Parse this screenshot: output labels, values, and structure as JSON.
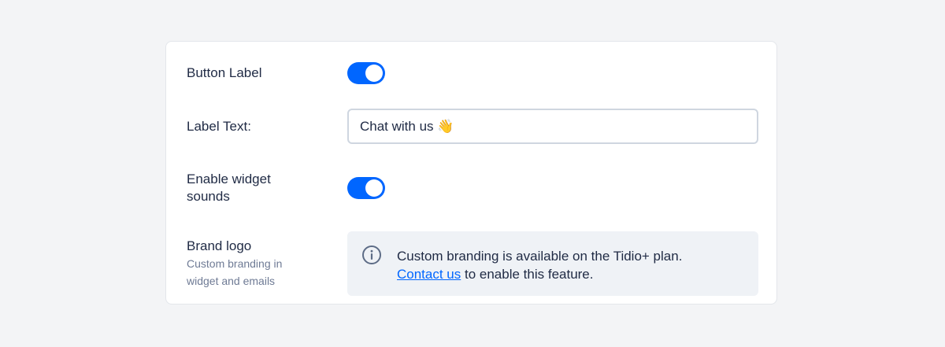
{
  "settings": {
    "button_label": {
      "label": "Button Label",
      "enabled": true
    },
    "label_text": {
      "label": "Label Text:",
      "value": "Chat with us 👋"
    },
    "widget_sounds": {
      "label": "Enable widget sounds",
      "enabled": true
    },
    "brand_logo": {
      "label": "Brand logo",
      "description_line1": "Custom branding in",
      "description_line2": "widget and emails",
      "info_text": "Custom branding is available on the Tidio+ plan.",
      "link_text": "Contact us",
      "after_link_text": " to enable this feature.",
      "icon": "info-icon"
    }
  },
  "colors": {
    "accent": "#0066ff",
    "page_background": "#f3f4f6",
    "card_background": "#ffffff",
    "info_background": "#eff2f6",
    "text": "#1f2a44",
    "muted_text": "#6f7b95"
  }
}
